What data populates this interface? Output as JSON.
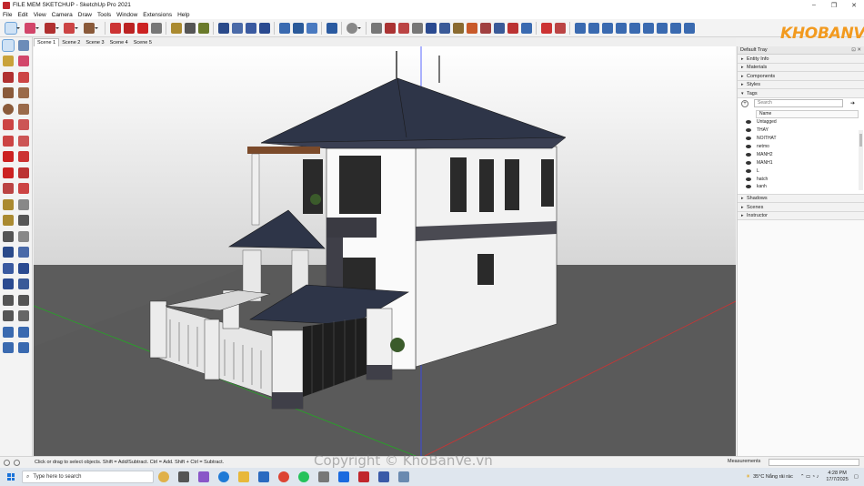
{
  "window": {
    "title": "FILE MEM SKETCHUP - SketchUp Pro 2021"
  },
  "menu": [
    "File",
    "Edit",
    "View",
    "Camera",
    "Draw",
    "Tools",
    "Window",
    "Extensions",
    "Help"
  ],
  "logo": {
    "text": "KHOBANVE"
  },
  "scenes": [
    "Scene 1",
    "Scene 2",
    "Scene 3",
    "Scene 4",
    "Scene 5"
  ],
  "tray": {
    "title": "Default Tray",
    "panels_top": [
      "Entity Info",
      "Materials",
      "Components",
      "Styles",
      "Tags"
    ],
    "search_placeholder": "Search",
    "name_header": "Name",
    "tags": [
      "Untagged",
      "THAY",
      "NOITHAT",
      "netmo",
      "MANH2",
      "MANH1",
      "L",
      "hatch",
      "kanh"
    ],
    "panels_bottom": [
      "Shadows",
      "Scenes",
      "Instructor"
    ]
  },
  "status": {
    "hint": "Click or drag to select objects. Shift = Add/Subtract. Ctrl = Add. Shift + Ctrl = Subtract.",
    "measurements_label": "Measurements"
  },
  "taskbar": {
    "search_placeholder": "Type here to search",
    "weather": "35°C  Nắng rải rác",
    "time": "4:28 PM",
    "date": "17/7/2025"
  },
  "watermark": "Copyright © KhoBanVe.vn",
  "colors": {
    "ground": "#5a5a5a",
    "sky": "#dcdcdc",
    "roof": "#2e3548",
    "wall": "#f4f4f4",
    "accent_logo": "#f29a1f"
  }
}
